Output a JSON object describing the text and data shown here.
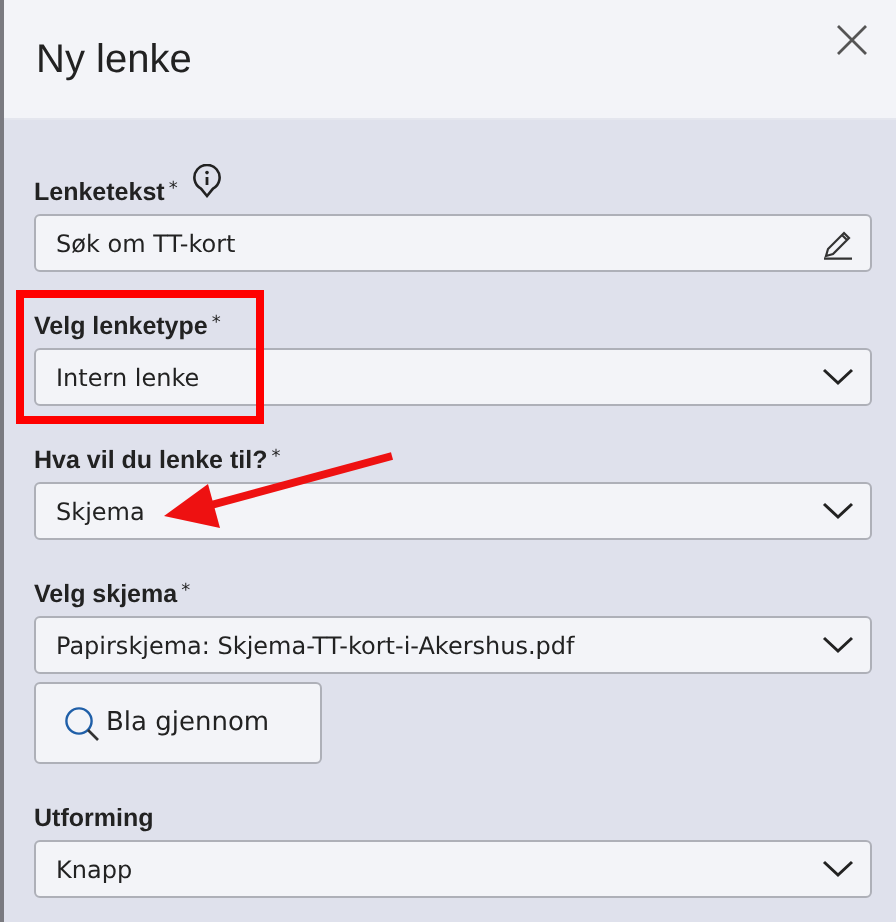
{
  "dialog": {
    "title": "Ny lenke"
  },
  "fields": [
    {
      "label": "Lenketekst",
      "required": true,
      "info": true,
      "kind": "text",
      "value": "Søk om TT-kort"
    },
    {
      "label": "Velg lenketype",
      "required": true,
      "info": false,
      "kind": "select",
      "value": "Intern lenke"
    },
    {
      "label": "Hva vil du lenke til?",
      "required": true,
      "info": false,
      "kind": "select",
      "value": "Skjema"
    },
    {
      "label": "Velg skjema",
      "required": true,
      "info": false,
      "kind": "select",
      "value": "Papirskjema: Skjema-TT-kort-i-Akershus.pdf",
      "button": "Bla gjennom"
    },
    {
      "label": "Utforming",
      "required": false,
      "info": false,
      "kind": "select",
      "value": "Knapp"
    }
  ],
  "required_mark": "*"
}
